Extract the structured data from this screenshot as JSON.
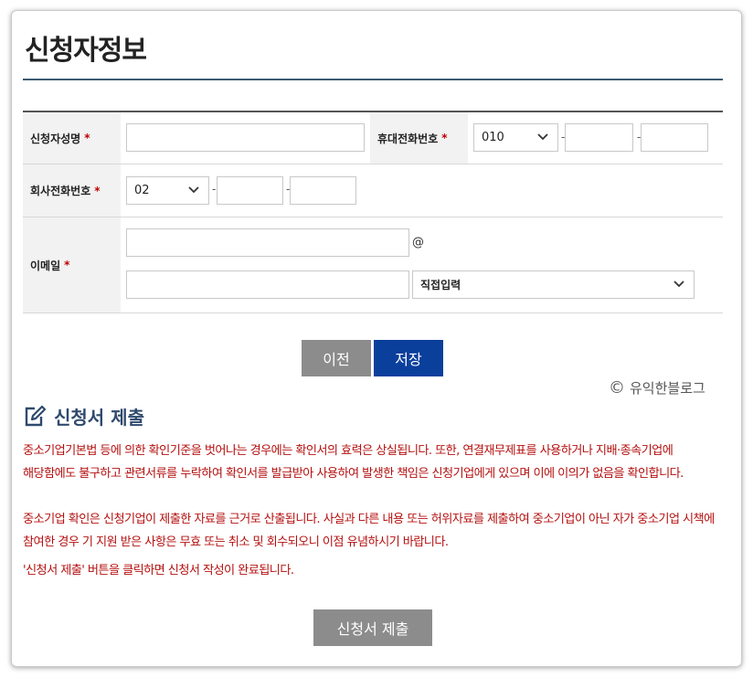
{
  "page": {
    "title": "신청자정보"
  },
  "form": {
    "name_label": "신청자성명",
    "mobile_label": "휴대전화번호",
    "mobile_prefix": "010",
    "company_phone_label": "회사전화번호",
    "company_phone_prefix": "02",
    "email_label": "이메일",
    "email_at": "@",
    "email_domain_select": "직접입력",
    "required_mark": "*",
    "dash": "-"
  },
  "buttons": {
    "prev": "이전",
    "save": "저장",
    "submit": "신청서 제출"
  },
  "colors": {
    "prev_bg": "#8c8c8c",
    "save_bg": "#0a3f9c",
    "submit_bg": "#8c8c8c",
    "notice_text": "#b51010",
    "section_title": "#2f4a6d"
  },
  "watermark": {
    "symbol": "©",
    "text": "유익한블로그"
  },
  "submission": {
    "title": "신청서 제출",
    "icon": "edit-icon",
    "notices": [
      "중소기업기본법 등에 의한 확인기준을 벗어나는 경우에는 확인서의 효력은 상실됩니다. 또한, 연결재무제표를 사용하거나 지배·종속기업에 해당함에도 불구하고 관련서류를 누락하여 확인서를 발급받아 사용하여 발생한 책임은 신청기업에게 있으며 이에 이의가 없음을 확인합니다.",
      "중소기업 확인은 신청기업이 제출한 자료를 근거로 산출됩니다. 사실과 다른 내용 또는 허위자료를 제출하여 중소기업이 아닌 자가 중소기업 시책에 참여한 경우 기 지원 받은 사항은 무효 또는 취소 및 회수되오니 이점 유념하시기 바랍니다.",
      "'신청서 제출' 버튼을 클릭하면 신청서 작성이 완료됩니다."
    ]
  }
}
